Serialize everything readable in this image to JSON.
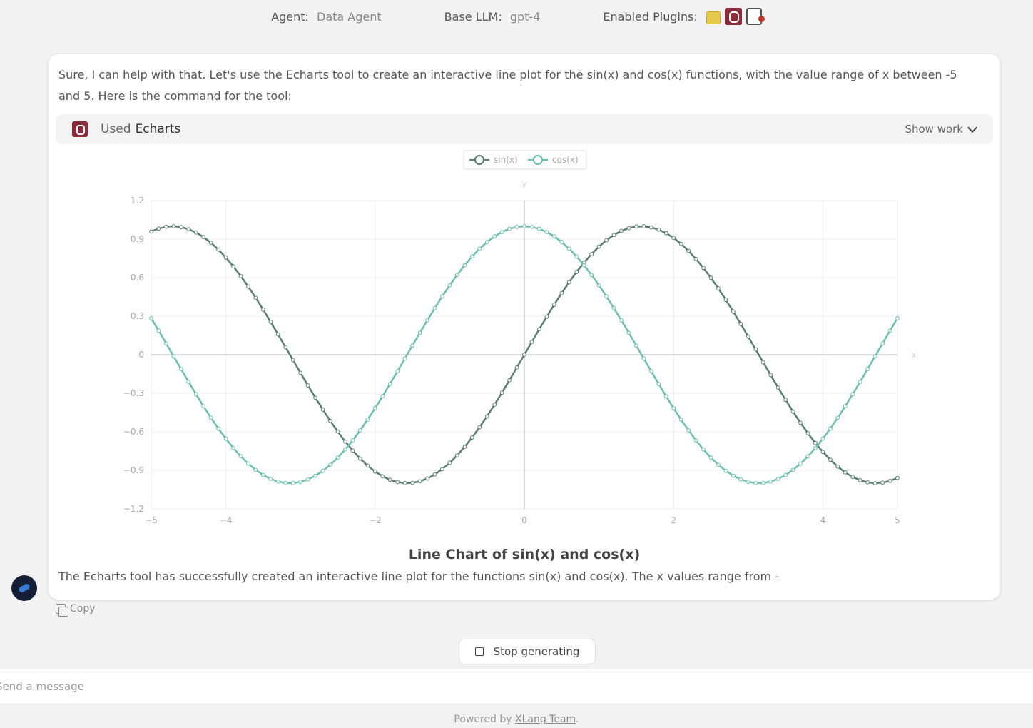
{
  "header": {
    "agent_label": "Agent:",
    "agent_value": "Data Agent",
    "llm_label": "Base LLM:",
    "llm_value": "gpt-4",
    "plugins_label": "Enabled Plugins:"
  },
  "message": {
    "intro": "Sure, I can help with that. Let's use the Echarts tool to create an interactive line plot for the sin(x) and cos(x) functions, with the value range of x between -5 and 5. Here is the command for the tool:",
    "tool_used_label": "Used",
    "tool_name": "Echarts",
    "show_work_label": "Show work",
    "summary": "The Echarts tool has successfully created an interactive line plot for the functions sin(x) and cos(x). The x values range from -"
  },
  "chart_data": {
    "type": "line",
    "title": "Line Chart of sin(x) and cos(x)",
    "xlabel": "x",
    "ylabel": "y",
    "xlim": [
      -5,
      5
    ],
    "ylim": [
      -1.2,
      1.2
    ],
    "x_ticks": [
      -5,
      -4,
      -2,
      0,
      2,
      4,
      5
    ],
    "x_tick_labels": [
      "−5",
      "−4",
      "−2",
      "0",
      "2",
      "4",
      "5"
    ],
    "y_ticks": [
      -1.2,
      -0.9,
      -0.6,
      -0.3,
      0,
      0.3,
      0.6,
      0.9,
      1.2
    ],
    "y_tick_labels": [
      "−1.2",
      "−0.9",
      "−0.6",
      "−0.3",
      "0",
      "0.3",
      "0.6",
      "0.9",
      "1.2"
    ],
    "grid": true,
    "legend_position": "top-center",
    "series": [
      {
        "name": "sin(x)",
        "function": "sin",
        "color": "#5a7d73"
      },
      {
        "name": "cos(x)",
        "function": "cos",
        "color": "#6cc0a8"
      }
    ],
    "x_step": 0.1
  },
  "actions": {
    "copy_label": "Copy",
    "stop_label": "Stop generating"
  },
  "input": {
    "placeholder": "Send a message"
  },
  "footer": {
    "prefix": "Powered by",
    "link": "XLang Team",
    "suffix": "."
  }
}
